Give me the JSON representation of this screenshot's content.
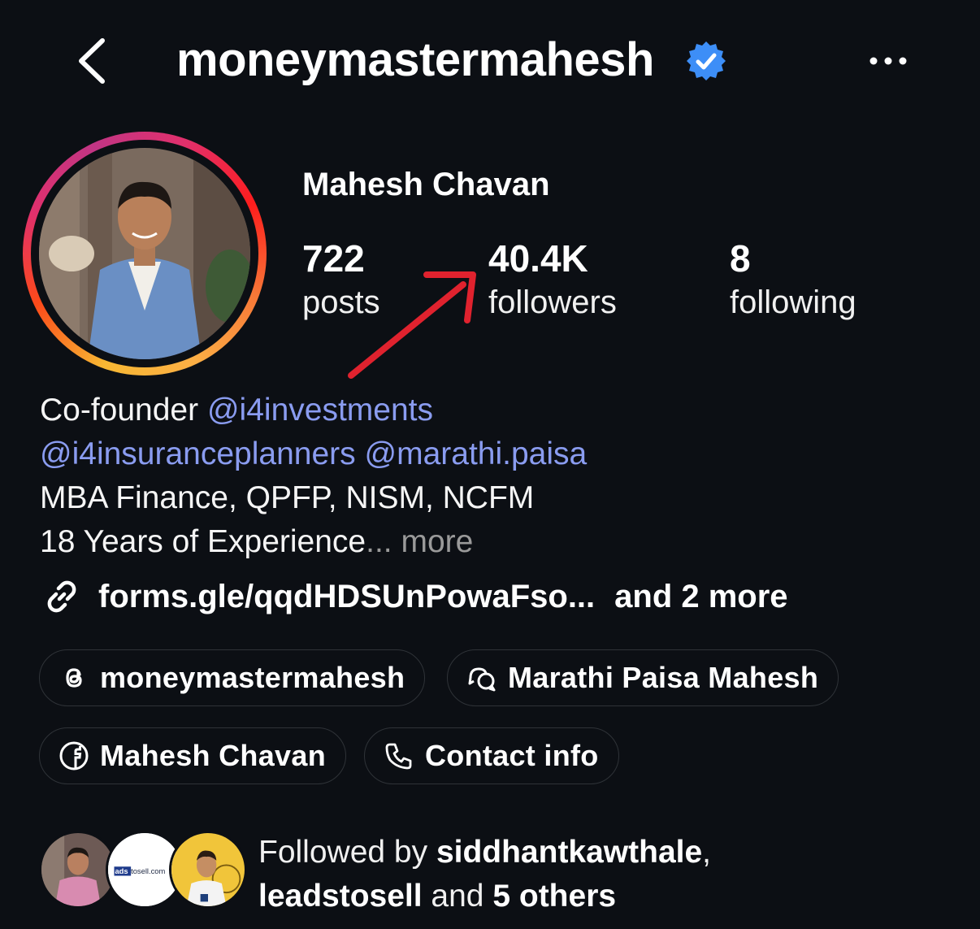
{
  "header": {
    "username": "moneymastermahesh",
    "verified": true,
    "icons": [
      "back-chevron-icon",
      "verified-badge-icon",
      "more-dots-icon"
    ]
  },
  "profile": {
    "full_name": "Mahesh Chavan",
    "stats": [
      {
        "num": "722",
        "label": "posts"
      },
      {
        "num": "40.4K",
        "label": "followers"
      },
      {
        "num": "8",
        "label": "following"
      }
    ]
  },
  "bio": {
    "line1_text": "Co-founder ",
    "line1_mention": "@i4investments",
    "line2_mention_a": "@i4insuranceplanners",
    "line2_mention_b": "@marathi.paisa",
    "line3": "MBA Finance, QPFP, NISM, NCFM",
    "line4": "18 Years of Experience",
    "ellipsis": "...",
    "more": "more"
  },
  "links": {
    "primary": "forms.gle/qqdHDSUnPowaFso...",
    "extra": "and 2 more"
  },
  "chips": [
    {
      "label": "moneymastermahesh",
      "icon": "threads-icon"
    },
    {
      "label": "Marathi Paisa Mahesh",
      "icon": "chat-bubbles-icon"
    },
    {
      "label": "Mahesh Chavan",
      "icon": "facebook-icon"
    },
    {
      "label": "Contact info",
      "icon": "phone-icon"
    }
  ],
  "followed_by": {
    "prefix": "Followed by ",
    "user1": "siddhantkawthale",
    "sep": ",",
    "user2": "leadstosell",
    "and": " and ",
    "others": "5 others",
    "avatar2_text": "adstosell.com"
  },
  "colors": {
    "background": "#0c0f14",
    "mention": "#8a9cf0",
    "verified": "#3d8ef7",
    "annotation_arrow": "#e0222e"
  }
}
